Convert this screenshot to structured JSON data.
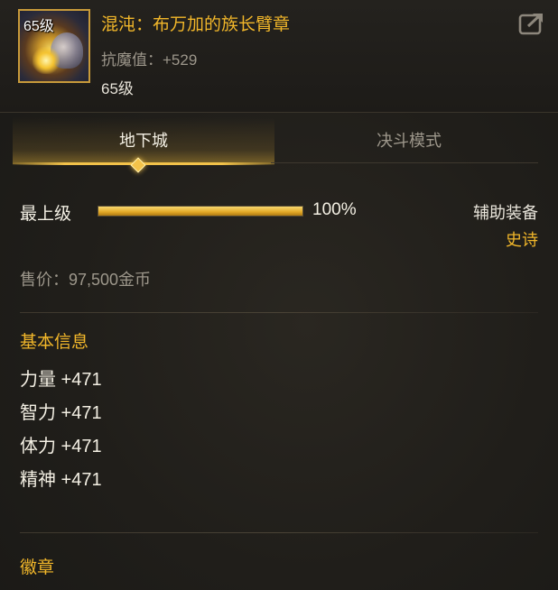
{
  "item": {
    "icon_level": "65级",
    "name": "混沌：布万加的族长臂章",
    "resist": "抗魔值：+529",
    "required_level": "65级",
    "icon": "share-icon"
  },
  "tabs": [
    {
      "label": "地下城",
      "active": true
    },
    {
      "label": "决斗模式",
      "active": false
    }
  ],
  "grade": {
    "label": "最上级",
    "percent_text": "100%",
    "fill_fraction": 1.0,
    "slot_type": "辅助装备",
    "rarity": "史诗"
  },
  "price": "售价：97,500金币",
  "basic_info": {
    "title": "基本信息",
    "stats": [
      "力量 +471",
      "智力 +471",
      "体力 +471",
      "精神 +471"
    ]
  },
  "emblem": {
    "title": "徽章"
  },
  "colors": {
    "accent_gold": "#f2b72a",
    "muted": "#9d978b",
    "text": "#f4f0e4"
  }
}
